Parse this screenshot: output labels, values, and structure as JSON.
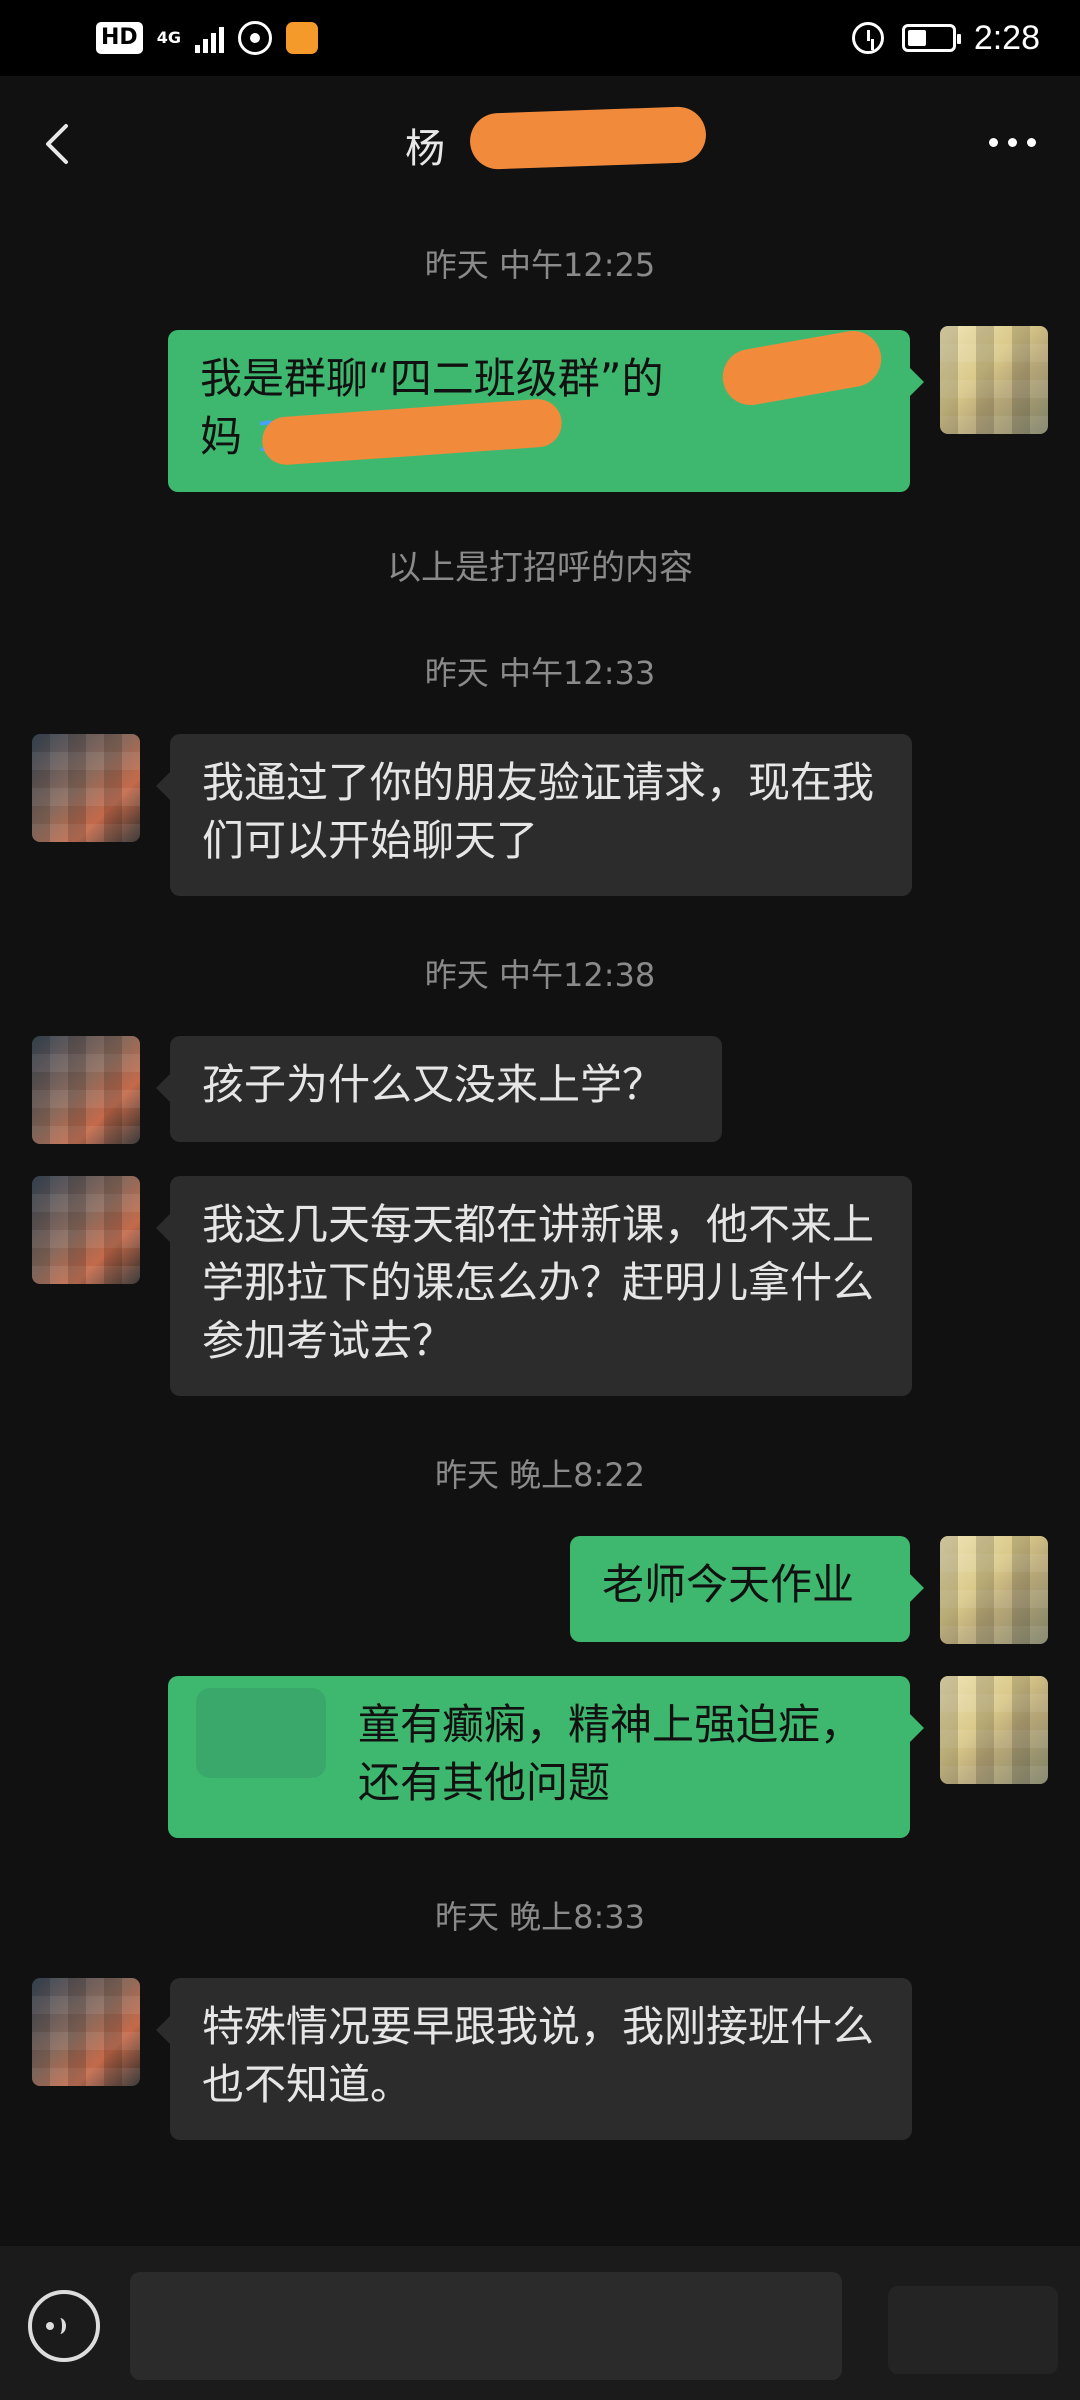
{
  "status_bar": {
    "hd": "HD",
    "network": "4G",
    "time": "2:28"
  },
  "header": {
    "title_visible": "杨"
  },
  "messages": [
    {
      "type": "time",
      "text": "昨天 中午12:25"
    },
    {
      "type": "out",
      "line1": "我是群聊“四二班级群”的",
      "line2_prefix": "妈 ",
      "phone_visible": "1"
    },
    {
      "type": "system",
      "text": "以上是打招呼的内容"
    },
    {
      "type": "time",
      "text": "昨天 中午12:33"
    },
    {
      "type": "in",
      "text": "我通过了你的朋友验证请求，现在我们可以开始聊天了"
    },
    {
      "type": "time",
      "text": "昨天 中午12:38"
    },
    {
      "type": "in",
      "text": "孩子为什么又没来上学？"
    },
    {
      "type": "in",
      "text": "我这几天每天都在讲新课，他不来上学那拉下的课怎么办？赶明儿拿什么参加考试去？"
    },
    {
      "type": "time",
      "text": "昨天 晚上8:22"
    },
    {
      "type": "out",
      "text": "老师今天作业"
    },
    {
      "type": "out",
      "text": "童有癫痫，精神上强迫症，还有其他问题"
    },
    {
      "type": "time",
      "text": "昨天 晚上8:33"
    },
    {
      "type": "in",
      "text": "特殊情况要早跟我说，我刚接班什么也不知道。"
    }
  ],
  "icons": {
    "back": "chevron-left-icon",
    "more": "more-dots-icon",
    "voice": "voice-icon"
  }
}
